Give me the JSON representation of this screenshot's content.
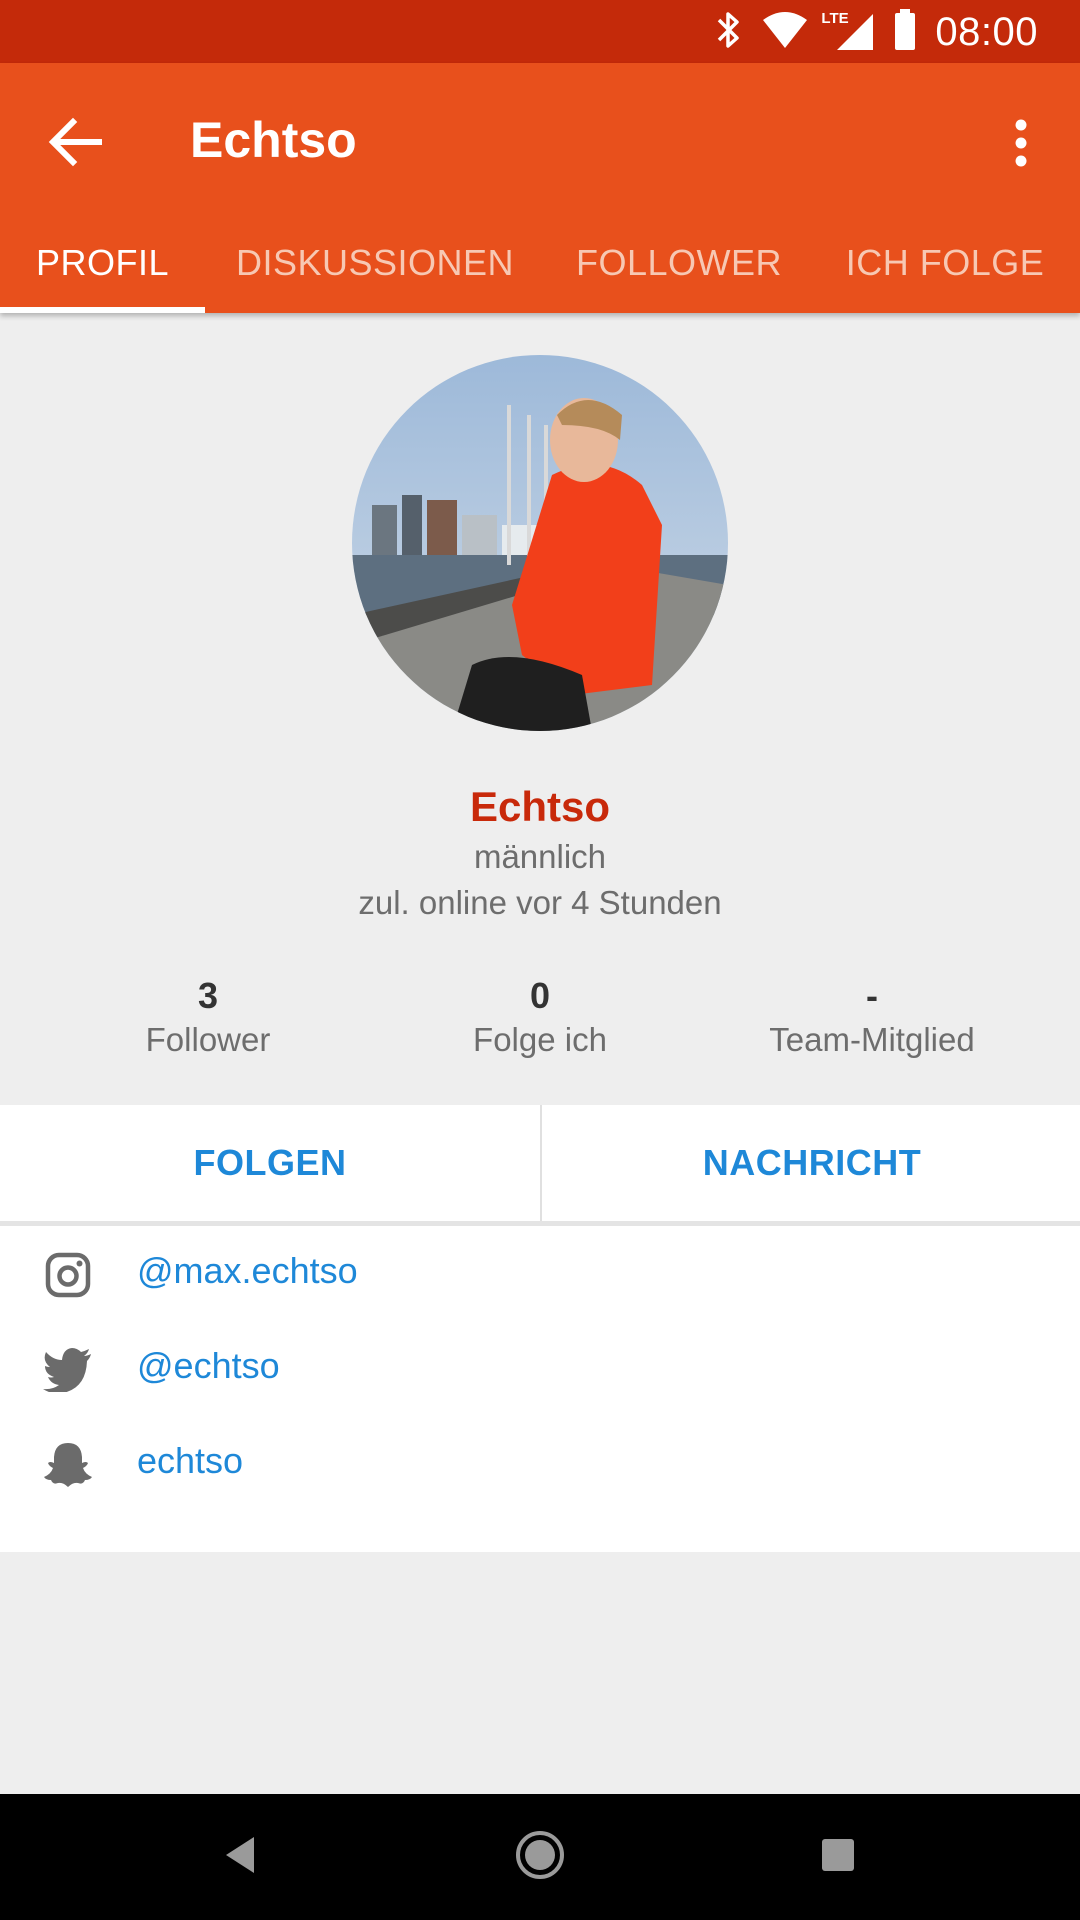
{
  "status_bar": {
    "time": "08:00",
    "icons": [
      "bluetooth-icon",
      "wifi-icon",
      "lte-signal-icon",
      "battery-icon"
    ],
    "lte_label": "LTE"
  },
  "app_bar": {
    "title": "Echtso",
    "back_icon": "arrow-back-icon",
    "menu_icon": "more-vert-icon",
    "color": "#e8501c"
  },
  "tabs": [
    {
      "label": "PROFIL",
      "active": true
    },
    {
      "label": "DISKUSSIONEN",
      "active": false
    },
    {
      "label": "FOLLOWER",
      "active": false
    },
    {
      "label": "ICH FOLGE",
      "active": false
    }
  ],
  "profile": {
    "name": "Echtso",
    "gender": "männlich",
    "last_online": "zul. online vor 4 Stunden",
    "name_color": "#c8290a",
    "stats": [
      {
        "value": "3",
        "label": "Follower"
      },
      {
        "value": "0",
        "label": "Folge ich"
      },
      {
        "value": "-",
        "label": "Team-Mitglied"
      }
    ]
  },
  "actions": {
    "follow_label": "FOLGEN",
    "message_label": "NACHRICHT",
    "accent": "#1e88d8"
  },
  "social": [
    {
      "icon": "instagram-icon",
      "handle": "@max.echtso"
    },
    {
      "icon": "twitter-icon",
      "handle": "@echtso"
    },
    {
      "icon": "snapchat-icon",
      "handle": "echtso"
    }
  ],
  "nav_bar": {
    "icons": [
      "nav-back-icon",
      "nav-home-icon",
      "nav-recents-icon"
    ]
  }
}
